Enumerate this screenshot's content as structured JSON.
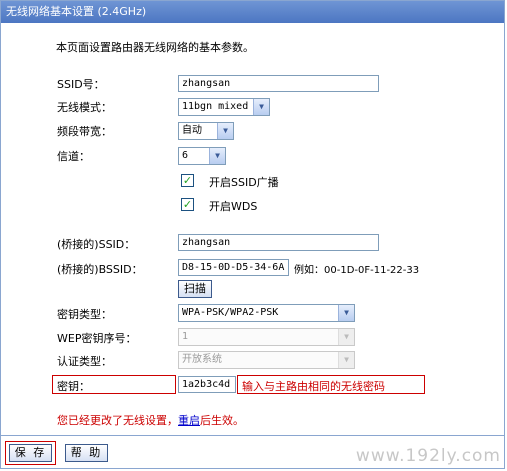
{
  "window": {
    "title": "无线网络基本设置 (2.4GHz)"
  },
  "description": "本页面设置路由器无线网络的基本参数。",
  "ssid": {
    "label": "SSID号：",
    "value": "zhangsan"
  },
  "mode": {
    "label": "无线模式：",
    "value": "11bgn mixed"
  },
  "bandwidth": {
    "label": "频段带宽：",
    "value": "自动"
  },
  "channel": {
    "label": "信道：",
    "value": "6"
  },
  "ssid_broadcast": {
    "label": "开启SSID广播",
    "checked": true
  },
  "wds": {
    "label": "开启WDS",
    "checked": true
  },
  "bridge_ssid": {
    "label": "(桥接的)SSID：",
    "value": "zhangsan"
  },
  "bridge_bssid": {
    "label": "(桥接的)BSSID：",
    "value": "D8-15-0D-D5-34-6A",
    "example": "例如：00-1D-0F-11-22-33"
  },
  "scan_button": "扫描",
  "key_type": {
    "label": "密钥类型：",
    "value": "WPA-PSK/WPA2-PSK"
  },
  "wep_index": {
    "label": "WEP密钥序号：",
    "value": "1"
  },
  "auth_type": {
    "label": "认证类型：",
    "value": "开放系统"
  },
  "key": {
    "label": "密钥：",
    "value": "1a2b3c4d",
    "hint": "输入与主路由相同的无线密码"
  },
  "notice": {
    "before": "您已经更改了无线设置，",
    "link": "重启",
    "after": "后生效。"
  },
  "buttons": {
    "save": "保 存",
    "help": "帮 助"
  },
  "watermark": "www.192ly.com",
  "colors": {
    "title_bar": "#5a81c8",
    "highlight": "#cc0000",
    "check": "#21a121"
  }
}
